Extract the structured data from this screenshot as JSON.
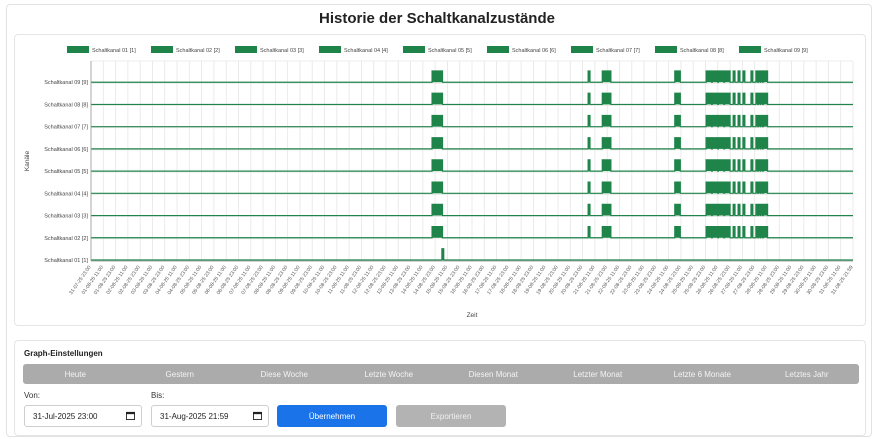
{
  "page": {
    "title": "Historie der Schaltkanalzustände"
  },
  "colors": {
    "series": "#1e8449",
    "primary_button": "#1a73e8",
    "range_bar": "#ababab"
  },
  "chart_data": {
    "type": "line",
    "style": "step",
    "ylabel": "Kanäle",
    "xlabel": "Zeit",
    "legend_position": "top",
    "grid": true,
    "x_ticks": [
      "31-07-25 23:00",
      "01-08-25 11:00",
      "01-08-25 23:00",
      "02-08-25 11:00",
      "02-08-25 23:00",
      "03-08-25 11:00",
      "03-08-25 23:00",
      "04-08-25 11:00",
      "04-08-25 23:00",
      "05-08-25 11:00",
      "05-08-25 23:00",
      "06-08-25 11:00",
      "06-08-25 23:00",
      "07-08-25 11:00",
      "07-08-25 23:00",
      "08-08-25 11:00",
      "08-08-25 23:00",
      "09-08-25 11:00",
      "09-08-25 23:00",
      "10-08-25 11:00",
      "10-08-25 23:00",
      "11-08-25 11:00",
      "11-08-25 23:00",
      "12-08-25 11:00",
      "12-08-25 23:00",
      "13-08-25 11:00",
      "13-08-25 23:00",
      "14-08-25 11:00",
      "14-08-25 23:00",
      "15-08-25 11:00",
      "15-08-25 23:00",
      "16-08-25 11:00",
      "16-08-25 23:00",
      "17-08-25 11:00",
      "17-08-25 23:00",
      "18-08-25 11:00",
      "18-08-25 23:00",
      "19-08-25 11:00",
      "19-08-25 23:00",
      "20-08-25 11:00",
      "20-08-25 23:00",
      "21-08-25 11:00",
      "21-08-25 23:00",
      "22-08-25 11:00",
      "22-08-25 23:00",
      "23-08-25 11:00",
      "23-08-25 23:00",
      "24-08-25 11:00",
      "24-08-25 23:00",
      "25-08-25 11:00",
      "25-08-25 23:00",
      "26-08-25 11:00",
      "26-08-25 23:00",
      "27-08-25 11:00",
      "27-08-25 23:00",
      "28-08-25 11:00",
      "28-08-25 23:00",
      "29-08-25 11:00",
      "29-08-25 23:00",
      "30-08-25 11:00",
      "30-08-25 23:00",
      "31-08-25 11:00",
      "31-08-25 21:59"
    ],
    "channels": [
      {
        "name": "Schaltkanal 01 [1]",
        "on_intervals": [
          [
            28.55,
            28.7
          ]
        ]
      },
      {
        "name": "Schaltkanal 02 [2]",
        "on_intervals": [
          [
            27.75,
            28.6
          ],
          [
            40.45,
            40.6
          ],
          [
            41.6,
            42.3
          ],
          [
            47.5,
            47.95
          ],
          [
            50.05,
            50.5
          ],
          [
            50.55,
            51.0
          ],
          [
            51.05,
            51.5
          ],
          [
            51.55,
            52.0
          ],
          [
            52.25,
            52.4
          ],
          [
            52.65,
            52.8
          ],
          [
            53.05,
            53.2
          ],
          [
            53.7,
            53.85
          ],
          [
            54.1,
            54.25
          ],
          [
            54.3,
            54.45
          ],
          [
            54.5,
            54.65
          ],
          [
            54.7,
            55.05
          ]
        ]
      },
      {
        "name": "Schaltkanal 03 [3]",
        "on_intervals": [
          [
            27.75,
            28.6
          ],
          [
            40.45,
            40.6
          ],
          [
            41.6,
            42.3
          ],
          [
            47.5,
            47.95
          ],
          [
            50.05,
            50.5
          ],
          [
            50.55,
            51.0
          ],
          [
            51.05,
            51.5
          ],
          [
            51.55,
            52.0
          ],
          [
            52.25,
            52.4
          ],
          [
            52.65,
            52.8
          ],
          [
            53.05,
            53.2
          ],
          [
            53.7,
            53.85
          ],
          [
            54.1,
            54.25
          ],
          [
            54.3,
            54.45
          ],
          [
            54.5,
            54.65
          ],
          [
            54.7,
            55.05
          ]
        ]
      },
      {
        "name": "Schaltkanal 04 [4]",
        "on_intervals": [
          [
            27.75,
            28.6
          ],
          [
            40.45,
            40.6
          ],
          [
            41.6,
            42.3
          ],
          [
            47.5,
            47.95
          ],
          [
            50.05,
            50.5
          ],
          [
            50.55,
            51.0
          ],
          [
            51.05,
            51.5
          ],
          [
            51.55,
            52.0
          ],
          [
            52.25,
            52.4
          ],
          [
            52.65,
            52.8
          ],
          [
            53.05,
            53.2
          ],
          [
            53.7,
            53.85
          ],
          [
            54.1,
            54.25
          ],
          [
            54.3,
            54.45
          ],
          [
            54.5,
            54.65
          ],
          [
            54.7,
            55.05
          ]
        ]
      },
      {
        "name": "Schaltkanal 05 [5]",
        "on_intervals": [
          [
            27.75,
            28.6
          ],
          [
            40.45,
            40.6
          ],
          [
            41.6,
            42.3
          ],
          [
            47.5,
            47.95
          ],
          [
            50.05,
            50.5
          ],
          [
            50.55,
            51.0
          ],
          [
            51.05,
            51.5
          ],
          [
            51.55,
            52.0
          ],
          [
            52.25,
            52.4
          ],
          [
            52.65,
            52.8
          ],
          [
            53.05,
            53.2
          ],
          [
            53.7,
            53.85
          ],
          [
            54.1,
            54.25
          ],
          [
            54.3,
            54.45
          ],
          [
            54.5,
            54.65
          ],
          [
            54.7,
            55.05
          ]
        ]
      },
      {
        "name": "Schaltkanal 06 [6]",
        "on_intervals": [
          [
            27.75,
            28.6
          ],
          [
            40.45,
            40.6
          ],
          [
            41.6,
            42.3
          ],
          [
            47.5,
            47.95
          ],
          [
            50.05,
            50.5
          ],
          [
            50.55,
            51.0
          ],
          [
            51.05,
            51.5
          ],
          [
            51.55,
            52.0
          ],
          [
            52.25,
            52.4
          ],
          [
            52.65,
            52.8
          ],
          [
            53.05,
            53.2
          ],
          [
            53.7,
            53.85
          ],
          [
            54.1,
            54.25
          ],
          [
            54.3,
            54.45
          ],
          [
            54.5,
            54.65
          ],
          [
            54.7,
            55.05
          ]
        ]
      },
      {
        "name": "Schaltkanal 07 [7]",
        "on_intervals": [
          [
            27.75,
            28.6
          ],
          [
            40.45,
            40.6
          ],
          [
            41.6,
            42.3
          ],
          [
            47.5,
            47.95
          ],
          [
            50.05,
            50.5
          ],
          [
            50.55,
            51.0
          ],
          [
            51.05,
            51.5
          ],
          [
            51.55,
            52.0
          ],
          [
            52.25,
            52.4
          ],
          [
            52.65,
            52.8
          ],
          [
            53.05,
            53.2
          ],
          [
            53.7,
            53.85
          ],
          [
            54.1,
            54.25
          ],
          [
            54.3,
            54.45
          ],
          [
            54.5,
            54.65
          ],
          [
            54.7,
            55.05
          ]
        ]
      },
      {
        "name": "Schaltkanal 08 [8]",
        "on_intervals": [
          [
            27.75,
            28.6
          ],
          [
            40.45,
            40.6
          ],
          [
            41.6,
            42.3
          ],
          [
            47.5,
            47.95
          ],
          [
            50.05,
            50.5
          ],
          [
            50.55,
            51.0
          ],
          [
            51.05,
            51.5
          ],
          [
            51.55,
            52.0
          ],
          [
            52.25,
            52.4
          ],
          [
            52.65,
            52.8
          ],
          [
            53.05,
            53.2
          ],
          [
            53.7,
            53.85
          ],
          [
            54.1,
            54.25
          ],
          [
            54.3,
            54.45
          ],
          [
            54.5,
            54.65
          ],
          [
            54.7,
            55.05
          ]
        ]
      },
      {
        "name": "Schaltkanal 09 [9]",
        "on_intervals": [
          [
            27.75,
            28.6
          ],
          [
            40.45,
            40.6
          ],
          [
            41.6,
            42.3
          ],
          [
            47.5,
            47.95
          ],
          [
            50.05,
            50.5
          ],
          [
            50.55,
            51.0
          ],
          [
            51.05,
            51.5
          ],
          [
            51.55,
            52.0
          ],
          [
            52.25,
            52.4
          ],
          [
            52.65,
            52.8
          ],
          [
            53.05,
            53.2
          ],
          [
            53.7,
            53.85
          ],
          [
            54.1,
            54.25
          ],
          [
            54.3,
            54.45
          ],
          [
            54.5,
            54.65
          ],
          [
            54.7,
            55.05
          ]
        ]
      }
    ]
  },
  "settings": {
    "title": "Graph-Einstellungen",
    "ranges": [
      "Heute",
      "Gestern",
      "Diese Woche",
      "Letzte Woche",
      "Diesen Monat",
      "Letzter Monat",
      "Letzte 6 Monate",
      "Letztes Jahr"
    ],
    "from_label": "Von:",
    "from_value": "31-Jul-2025 23:00",
    "to_label": "Bis:",
    "to_value": "31-Aug-2025 21:59",
    "apply_label": "Übernehmen",
    "export_label": "Exportieren"
  }
}
